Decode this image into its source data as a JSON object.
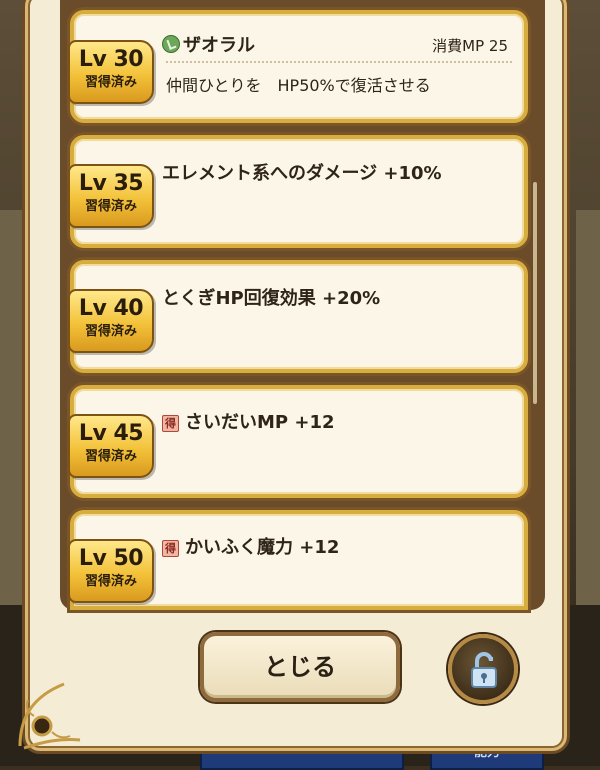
{
  "skills": [
    {
      "level": "Lv 30",
      "status": "習得済み",
      "name": "ザオラル",
      "mp_cost": "消費MP 25",
      "description": "仲間ひとりを　HP50%で復活させる",
      "icon": "herb-icon"
    },
    {
      "level": "Lv 35",
      "status": "習得済み",
      "name": "エレメント系へのダメージ +10%"
    },
    {
      "level": "Lv 40",
      "status": "習得済み",
      "name": "とくぎHP回復効果 +20%"
    },
    {
      "level": "Lv 45",
      "status": "習得済み",
      "name": "さいだいMP +12",
      "icon": "toku-icon",
      "icon_text": "得"
    },
    {
      "level": "Lv 50",
      "status": "習得済み",
      "name": "かいふく魔力 +12",
      "icon": "toku-icon",
      "icon_text": "得"
    }
  ],
  "close_button_label": "とじる",
  "lock_button_icon": "unlocked-padlock-icon",
  "background_tab_label": "能力",
  "colors": {
    "badge": "#f3c23a",
    "card_border": "#d8ad3f",
    "panel": "#6b4c2a"
  }
}
